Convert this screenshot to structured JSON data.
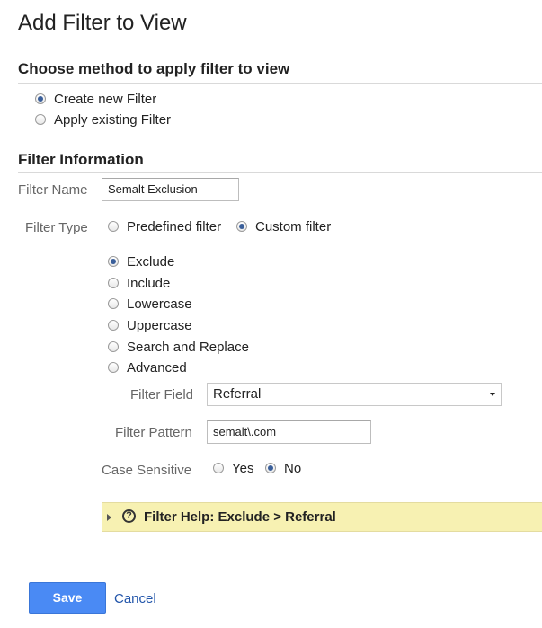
{
  "page": {
    "title": "Add Filter to View"
  },
  "method_section": {
    "heading": "Choose method to apply filter to view",
    "options": [
      {
        "label": "Create new Filter",
        "selected": true
      },
      {
        "label": "Apply existing Filter",
        "selected": false
      }
    ]
  },
  "filter_info": {
    "heading": "Filter Information",
    "filter_name": {
      "label": "Filter Name",
      "value": "Semalt Exclusion"
    },
    "filter_type": {
      "label": "Filter Type",
      "options": [
        {
          "label": "Predefined filter",
          "selected": false
        },
        {
          "label": "Custom filter",
          "selected": true
        }
      ]
    },
    "custom_options": [
      {
        "label": "Exclude",
        "selected": true
      },
      {
        "label": "Include",
        "selected": false
      },
      {
        "label": "Lowercase",
        "selected": false
      },
      {
        "label": "Uppercase",
        "selected": false
      },
      {
        "label": "Search and Replace",
        "selected": false
      },
      {
        "label": "Advanced",
        "selected": false
      }
    ],
    "filter_field": {
      "label": "Filter Field",
      "value": "Referral"
    },
    "filter_pattern": {
      "label": "Filter Pattern",
      "value": "semalt\\.com"
    },
    "case_sensitive": {
      "label": "Case Sensitive",
      "options": [
        {
          "label": "Yes",
          "selected": false
        },
        {
          "label": "No",
          "selected": true
        }
      ]
    }
  },
  "help_bar": {
    "icon": "question-circle-icon",
    "text": "Filter Help: Exclude  >  Referral",
    "background": "#f7f1b2"
  },
  "actions": {
    "save_label": "Save",
    "cancel_label": "Cancel",
    "accent": "#4a8af4"
  }
}
